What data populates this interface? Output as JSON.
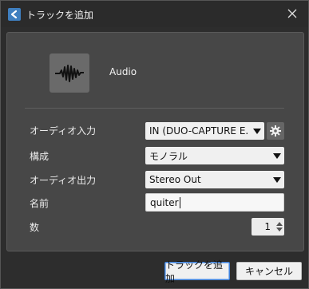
{
  "window": {
    "title": "トラックを追加",
    "app_icon": "cubase-logo-icon",
    "close_icon": "close-icon"
  },
  "track": {
    "type_label": "Audio",
    "icon": "audio-waveform-icon"
  },
  "fields": {
    "audio_input": {
      "label": "オーディオ入力",
      "value": "IN (DUO-CAPTURE E.",
      "settings_icon": "gear-icon"
    },
    "configuration": {
      "label": "構成",
      "value": "モノラル"
    },
    "audio_output": {
      "label": "オーディオ出力",
      "value": "Stereo Out"
    },
    "name": {
      "label": "名前",
      "value": "quiter"
    },
    "count": {
      "label": "数",
      "value": "1"
    }
  },
  "buttons": {
    "add_track": "トラックを追加",
    "cancel": "キャンセル"
  },
  "colors": {
    "title_bar": "#2b2b2b",
    "panel": "#474747",
    "icon_tile": "#6a6a6a",
    "accent": "#3d7fd8"
  }
}
